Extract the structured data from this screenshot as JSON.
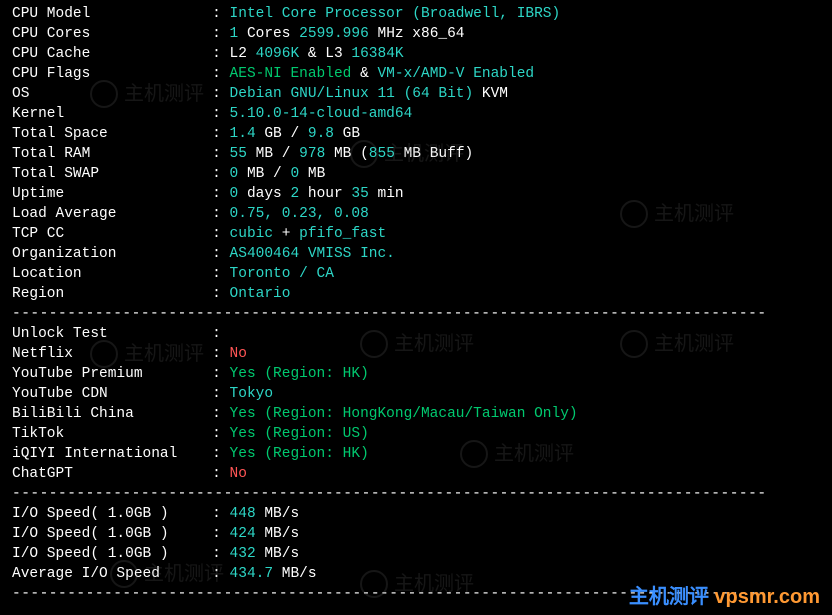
{
  "divider": "----------------------------------------------------------------------------------",
  "sysinfo": [
    {
      "label": "CPU Model",
      "segments": [
        {
          "t": "Intel Core Processor (Broadwell, IBRS)",
          "c": "cyan"
        }
      ]
    },
    {
      "label": "CPU Cores",
      "segments": [
        {
          "t": "1",
          "c": "cyan"
        },
        {
          "t": " Cores ",
          "c": "white"
        },
        {
          "t": "2599.996",
          "c": "cyan"
        },
        {
          "t": " MHz x86_64",
          "c": "white"
        }
      ]
    },
    {
      "label": "CPU Cache",
      "segments": [
        {
          "t": "L2 ",
          "c": "white"
        },
        {
          "t": "4096K",
          "c": "cyan"
        },
        {
          "t": " & L3 ",
          "c": "white"
        },
        {
          "t": "16384K",
          "c": "cyan"
        }
      ]
    },
    {
      "label": "CPU Flags",
      "segments": [
        {
          "t": "AES-NI Enabled",
          "c": "green"
        },
        {
          "t": " & ",
          "c": "white"
        },
        {
          "t": "VM-x/AMD-V Enabled",
          "c": "cyan"
        }
      ]
    },
    {
      "label": "OS",
      "segments": [
        {
          "t": "Debian GNU/Linux 11 (64 Bit)",
          "c": "cyan"
        },
        {
          "t": " KVM",
          "c": "white"
        }
      ]
    },
    {
      "label": "Kernel",
      "segments": [
        {
          "t": "5.10.0-14-cloud-amd64",
          "c": "cyan"
        }
      ]
    },
    {
      "label": "Total Space",
      "segments": [
        {
          "t": "1.4",
          "c": "cyan"
        },
        {
          "t": " GB / ",
          "c": "white"
        },
        {
          "t": "9.8",
          "c": "cyan"
        },
        {
          "t": " GB",
          "c": "white"
        }
      ]
    },
    {
      "label": "Total RAM",
      "segments": [
        {
          "t": "55",
          "c": "cyan"
        },
        {
          "t": " MB / ",
          "c": "white"
        },
        {
          "t": "978",
          "c": "cyan"
        },
        {
          "t": " MB (",
          "c": "white"
        },
        {
          "t": "855",
          "c": "cyan"
        },
        {
          "t": " MB Buff)",
          "c": "white"
        }
      ]
    },
    {
      "label": "Total SWAP",
      "segments": [
        {
          "t": "0",
          "c": "cyan"
        },
        {
          "t": " MB / ",
          "c": "white"
        },
        {
          "t": "0",
          "c": "cyan"
        },
        {
          "t": " MB",
          "c": "white"
        }
      ]
    },
    {
      "label": "Uptime",
      "segments": [
        {
          "t": "0",
          "c": "cyan"
        },
        {
          "t": " days ",
          "c": "white"
        },
        {
          "t": "2",
          "c": "cyan"
        },
        {
          "t": " hour ",
          "c": "white"
        },
        {
          "t": "35",
          "c": "cyan"
        },
        {
          "t": " min",
          "c": "white"
        }
      ]
    },
    {
      "label": "Load Average",
      "segments": [
        {
          "t": "0.75, 0.23, 0.08",
          "c": "cyan"
        }
      ]
    },
    {
      "label": "TCP CC",
      "segments": [
        {
          "t": "cubic",
          "c": "cyan"
        },
        {
          "t": " + ",
          "c": "white"
        },
        {
          "t": "pfifo_fast",
          "c": "cyan"
        }
      ]
    },
    {
      "label": "Organization",
      "segments": [
        {
          "t": "AS400464 VMISS Inc.",
          "c": "cyan"
        }
      ]
    },
    {
      "label": "Location",
      "segments": [
        {
          "t": "Toronto / CA",
          "c": "cyan"
        }
      ]
    },
    {
      "label": "Region",
      "segments": [
        {
          "t": "Ontario",
          "c": "cyan"
        }
      ]
    }
  ],
  "unlock_header": {
    "label": "Unlock Test",
    "segments": []
  },
  "unlock": [
    {
      "label": "Netflix",
      "segments": [
        {
          "t": "No",
          "c": "red"
        }
      ]
    },
    {
      "label": "YouTube Premium",
      "segments": [
        {
          "t": "Yes (Region: HK)",
          "c": "green"
        }
      ]
    },
    {
      "label": "YouTube CDN",
      "segments": [
        {
          "t": "Tokyo",
          "c": "cyan"
        }
      ]
    },
    {
      "label": "BiliBili China",
      "segments": [
        {
          "t": "Yes (Region: HongKong/Macau/Taiwan Only)",
          "c": "green"
        }
      ]
    },
    {
      "label": "TikTok",
      "segments": [
        {
          "t": "Yes (Region: US)",
          "c": "green"
        }
      ]
    },
    {
      "label": "iQIYI International",
      "segments": [
        {
          "t": "Yes (Region: HK)",
          "c": "green"
        }
      ]
    },
    {
      "label": "ChatGPT",
      "segments": [
        {
          "t": "No",
          "c": "red"
        }
      ]
    }
  ],
  "iospeed": [
    {
      "label": "I/O Speed( 1.0GB )",
      "segments": [
        {
          "t": "448",
          "c": "cyan"
        },
        {
          "t": " MB/s",
          "c": "white"
        }
      ]
    },
    {
      "label": "I/O Speed( 1.0GB )",
      "segments": [
        {
          "t": "424",
          "c": "cyan"
        },
        {
          "t": " MB/s",
          "c": "white"
        }
      ]
    },
    {
      "label": "I/O Speed( 1.0GB )",
      "segments": [
        {
          "t": "432",
          "c": "cyan"
        },
        {
          "t": " MB/s",
          "c": "white"
        }
      ]
    },
    {
      "label": "Average I/O Speed",
      "segments": [
        {
          "t": "434.7",
          "c": "cyan"
        },
        {
          "t": " MB/s",
          "c": "white"
        }
      ]
    }
  ],
  "watermark": {
    "cn": "主机测评",
    "en": " vpsmr.com"
  },
  "bg_watermark_text": "主机测评"
}
